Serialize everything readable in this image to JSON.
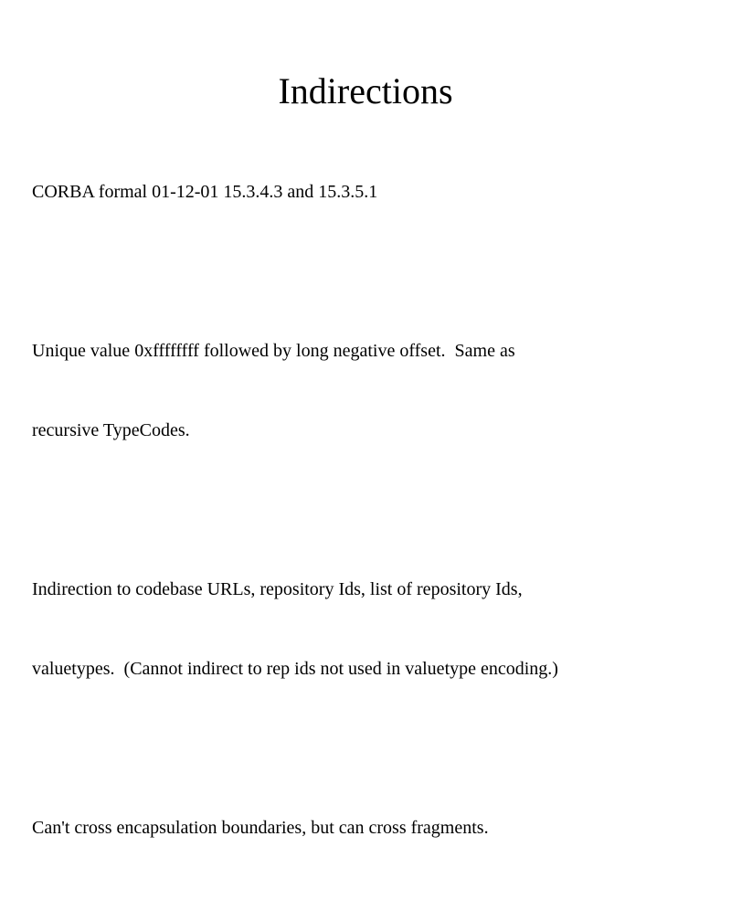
{
  "slide": {
    "title": "Indirections",
    "paragraphs": [
      {
        "lines": [
          "CORBA formal 01-12-01 15.3.4.3 and 15.3.5.1"
        ]
      },
      {
        "lines": [
          "Unique value 0xffffffff followed by long negative offset.  Same as",
          "recursive TypeCodes."
        ]
      },
      {
        "lines": [
          "Indirection to codebase URLs, repository Ids, list of repository Ids,",
          "valuetypes.  (Cannot indirect to rep ids not used in valuetype encoding.)"
        ]
      },
      {
        "lines": [
          "Can't cross encapsulation boundaries, but can cross fragments."
        ]
      }
    ]
  }
}
